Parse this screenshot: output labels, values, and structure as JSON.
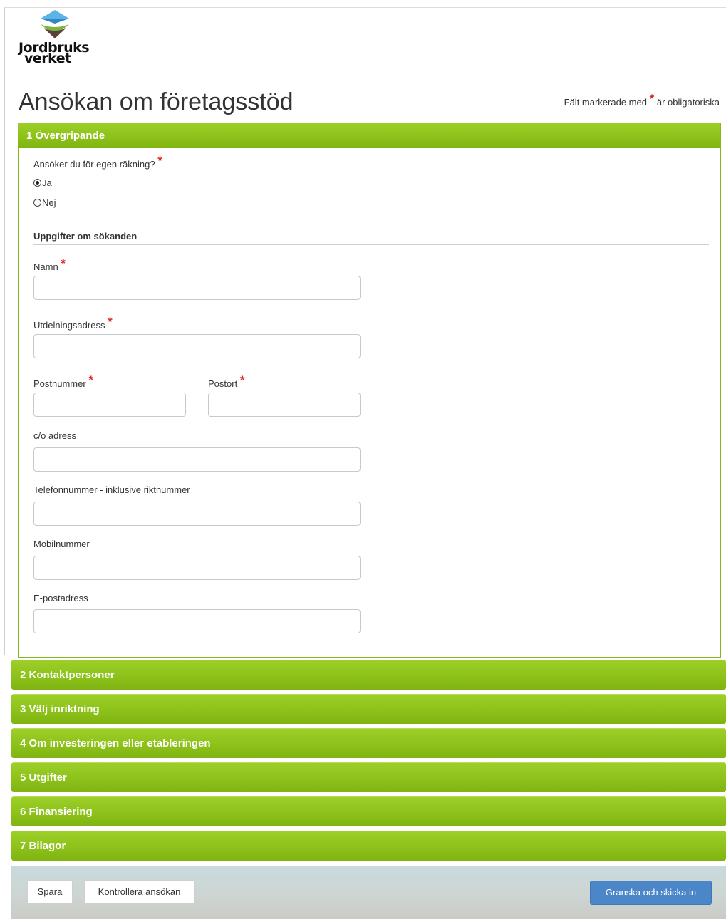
{
  "logo": {
    "line1": "Jordbruks",
    "line2": "verket"
  },
  "page": {
    "title": "Ansökan om företagsstöd",
    "required_note_before": "Fält markerade med",
    "required_star": "*",
    "required_note_after": "är obligatoriska"
  },
  "section1": {
    "header": "1 Övergripande",
    "question": "Ansöker du för egen räkning?",
    "options": [
      {
        "label": "Ja",
        "selected": true
      },
      {
        "label": "Nej",
        "selected": false
      }
    ],
    "subheading": "Uppgifter om sökanden",
    "fields": {
      "namn": {
        "label": "Namn",
        "value": ""
      },
      "utdelningsadress": {
        "label": "Utdelningsadress",
        "value": ""
      },
      "postnummer": {
        "label": "Postnummer",
        "value": ""
      },
      "postort": {
        "label": "Postort",
        "value": ""
      },
      "co_adress": {
        "label": "c/o adress",
        "value": ""
      },
      "telefon": {
        "label": "Telefonnummer - inklusive riktnummer",
        "value": ""
      },
      "mobil": {
        "label": "Mobilnummer",
        "value": ""
      },
      "epost": {
        "label": "E-postadress",
        "value": ""
      }
    }
  },
  "sections": [
    {
      "label": "2 Kontaktpersoner"
    },
    {
      "label": "3 Välj inriktning"
    },
    {
      "label": "4 Om investeringen eller etableringen"
    },
    {
      "label": "5 Utgifter"
    },
    {
      "label": "6 Finansiering"
    },
    {
      "label": "7 Bilagor"
    }
  ],
  "footer": {
    "save": "Spara",
    "check": "Kontrollera ansökan",
    "submit": "Granska och skicka in"
  },
  "colors": {
    "section_green": "#8dc21b",
    "required_red": "#e0221f",
    "primary_blue": "#4a86c8"
  },
  "icons": {
    "logo": "jordbruksverket-logo-icon"
  }
}
